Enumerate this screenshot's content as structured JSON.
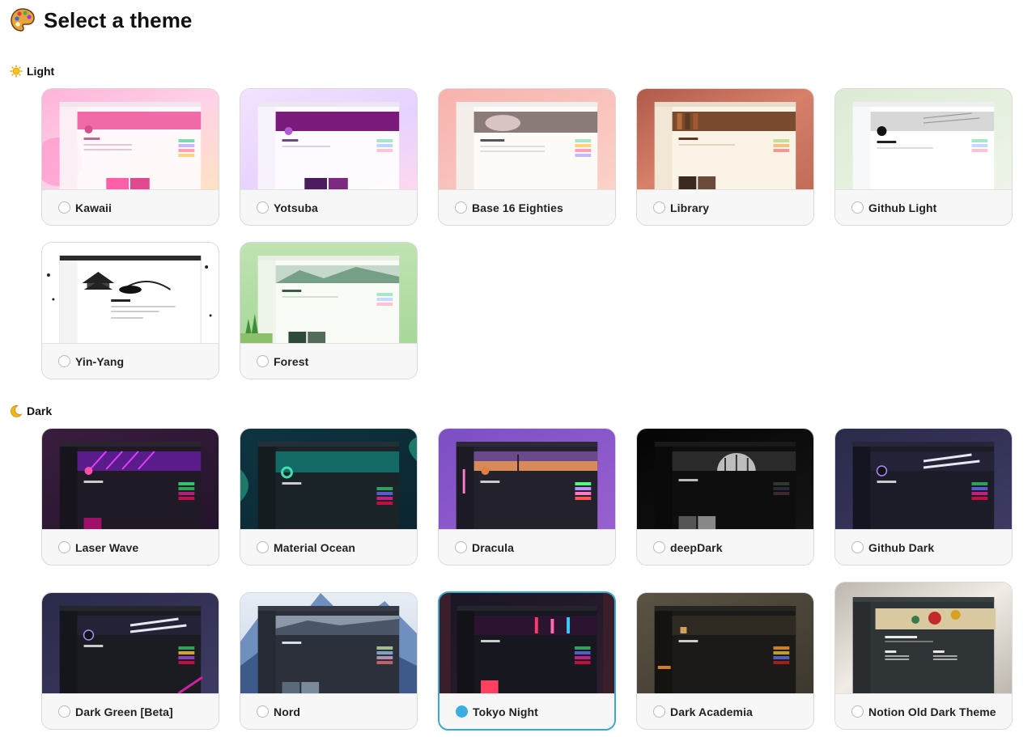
{
  "header": {
    "title": "Select a theme",
    "icon": "palette-icon"
  },
  "sections": {
    "light": {
      "label": "Light",
      "icon": "sun-icon"
    },
    "dark": {
      "label": "Dark",
      "icon": "crescent-moon-icon"
    }
  },
  "themes": {
    "kawaii": {
      "label": "Kawaii",
      "selected": false
    },
    "yotsuba": {
      "label": "Yotsuba",
      "selected": false
    },
    "base16": {
      "label": "Base 16 Eighties",
      "selected": false
    },
    "library": {
      "label": "Library",
      "selected": false
    },
    "github_light": {
      "label": "Github Light",
      "selected": false
    },
    "yin_yang": {
      "label": "Yin-Yang",
      "selected": false
    },
    "forest": {
      "label": "Forest",
      "selected": false
    },
    "laser_wave": {
      "label": "Laser Wave",
      "selected": false
    },
    "material_ocean": {
      "label": "Material Ocean",
      "selected": false
    },
    "dracula": {
      "label": "Dracula",
      "selected": false
    },
    "deepdark": {
      "label": "deepDark",
      "selected": false
    },
    "github_dark": {
      "label": "Github Dark",
      "selected": false
    },
    "dark_green": {
      "label": "Dark Green [Beta]",
      "selected": false
    },
    "nord": {
      "label": "Nord",
      "selected": false
    },
    "tokyo_night": {
      "label": "Tokyo Night",
      "selected": true
    },
    "dark_academia": {
      "label": "Dark Academia",
      "selected": false
    },
    "notion_old_dark": {
      "label": "Notion Old Dark Theme",
      "selected": false
    }
  },
  "colors": {
    "accent": "#3aaee0",
    "card_border": "#d9d9d9"
  }
}
